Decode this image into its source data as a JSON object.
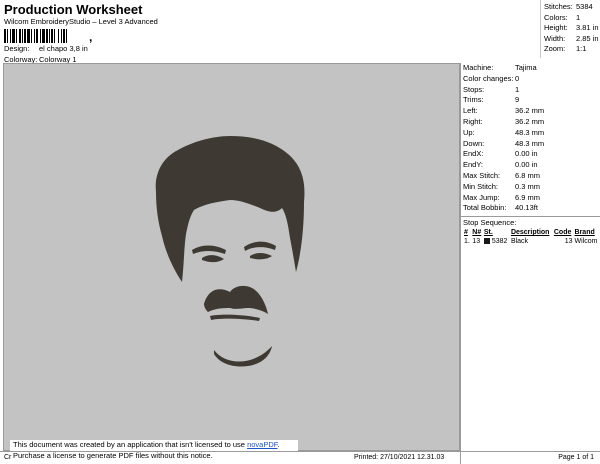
{
  "header": {
    "title": "Production Worksheet",
    "subtitle": "Wilcom EmbroideryStudio – Level 3 Advanced",
    "barcode_suffix": ",",
    "design_label": "Design:",
    "design_value": "el chapo 3,8 in",
    "colorway_label": "Colorway:",
    "colorway_value": "Colorway 1"
  },
  "stats": [
    {
      "label": "Stitches:",
      "value": "5384"
    },
    {
      "label": "Colors:",
      "value": "1"
    },
    {
      "label": "Height:",
      "value": "3.81 in"
    },
    {
      "label": "Width:",
      "value": "2.85 in"
    },
    {
      "label": "Zoom:",
      "value": "1:1"
    }
  ],
  "properties": [
    {
      "label": "Machine:",
      "value": "Tajima"
    },
    {
      "label": "Color changes:",
      "value": "0"
    },
    {
      "label": "Stops:",
      "value": "1"
    },
    {
      "label": "Trims:",
      "value": "9"
    },
    {
      "label": "Left:",
      "value": "36.2 mm"
    },
    {
      "label": "Right:",
      "value": "36.2 mm"
    },
    {
      "label": "Up:",
      "value": "48.3 mm"
    },
    {
      "label": "Down:",
      "value": "48.3 mm"
    },
    {
      "label": "EndX:",
      "value": "0.00 in"
    },
    {
      "label": "EndY:",
      "value": "0.00 in"
    },
    {
      "label": "Max Stitch:",
      "value": "6.8 mm"
    },
    {
      "label": "Min Stitch:",
      "value": "0.3 mm"
    },
    {
      "label": "Max Jump:",
      "value": "6.9 mm"
    },
    {
      "label": "Total Bobbin:",
      "value": "40.13ft"
    }
  ],
  "stop_sequence": {
    "title": "Stop Sequence:",
    "columns": [
      "#",
      "N#",
      "St.",
      "Description",
      "Code",
      "Brand"
    ],
    "rows": [
      {
        "index": "1.",
        "needle": "13",
        "stitches": "5382",
        "description": "Black",
        "code": "13",
        "brand": "Wilcom",
        "color": "#1a1a1a"
      }
    ]
  },
  "notice": {
    "line1_prefix": "This document was created by an application that isn't licensed to use ",
    "link": "novaPDF",
    "line1_suffix": ".",
    "line2": "Purchase a license to generate PDF files without this notice."
  },
  "footer": {
    "left": "Cr",
    "printed": "Printed: 27/10/2021 12.31.03",
    "page": "Page 1 of 1"
  },
  "colors": {
    "canvas": "#c3c3c3",
    "thread": "#3e3a33"
  }
}
